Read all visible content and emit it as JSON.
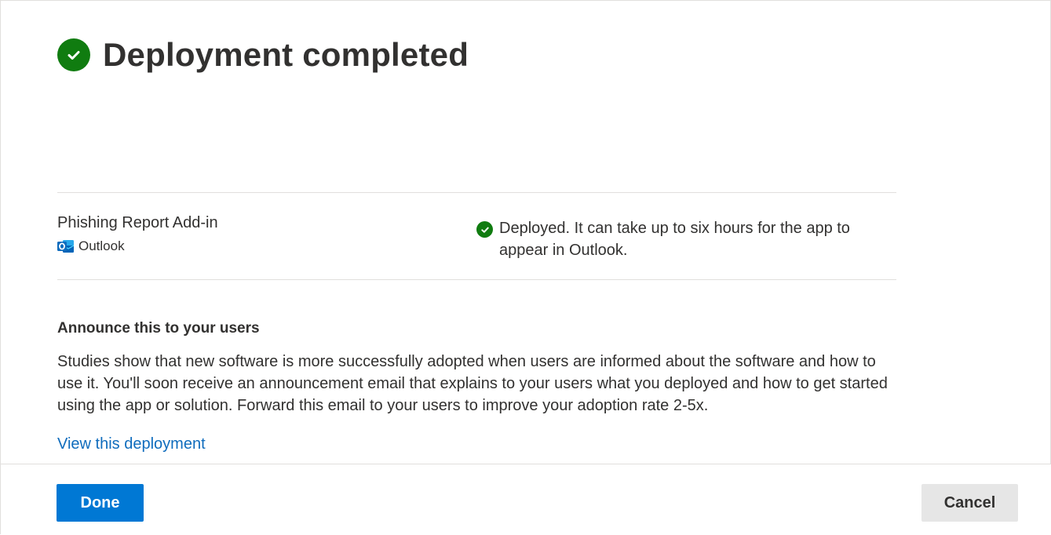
{
  "page": {
    "title": "Deployment completed"
  },
  "deployment": {
    "app_name": "Phishing Report Add-in",
    "platform": "Outlook",
    "status_text": "Deployed. It can take up to six hours for the app to appear in Outlook."
  },
  "announce": {
    "heading": "Announce this to your users",
    "body": "Studies show that new software is more successfully adopted when users are informed about the software and how to use it. You'll soon receive an announcement email that explains to your users what you deployed and how to get started using the app or solution. Forward this email to your users to improve your adoption rate 2-5x."
  },
  "links": {
    "view_deployment": "View this deployment"
  },
  "footer": {
    "done_label": "Done",
    "cancel_label": "Cancel"
  },
  "colors": {
    "success": "#107c10",
    "primary": "#0078d4",
    "link": "#0f6cbd",
    "secondary_button": "#e6e6e6"
  },
  "icons": {
    "title_status": "success-check-icon",
    "row_status": "success-check-icon",
    "platform": "outlook-icon"
  }
}
